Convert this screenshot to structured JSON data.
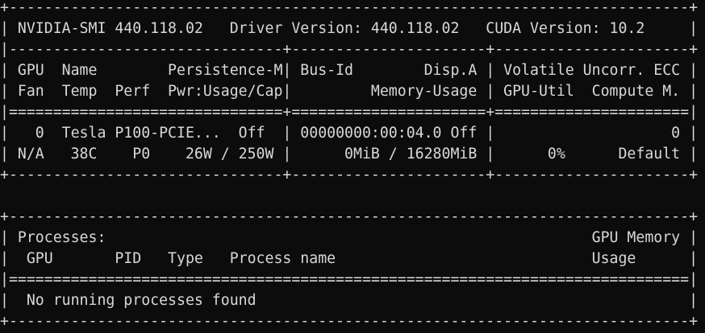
{
  "terminal": {
    "lines": [
      "+-----------------------------------------------------------------------------+",
      "| NVIDIA-SMI 440.118.02   Driver Version: 440.118.02   CUDA Version: 10.2     |",
      "|-------------------------------+----------------------+----------------------+",
      "| GPU  Name        Persistence-M| Bus-Id        Disp.A | Volatile Uncorr. ECC |",
      "| Fan  Temp  Perf  Pwr:Usage/Cap|         Memory-Usage | GPU-Util  Compute M. |",
      "|===============================+======================+======================|",
      "|   0  Tesla P100-PCIE...  Off  | 00000000:00:04.0 Off |                    0 |",
      "| N/A   38C    P0    26W / 250W |      0MiB / 16280MiB |      0%      Default |",
      "+-------------------------------+----------------------+----------------------+",
      "",
      "+-----------------------------------------------------------------------------+",
      "| Processes:                                                       GPU Memory |",
      "|  GPU       PID   Type   Process name                             Usage      |",
      "|=============================================================================|",
      "|  No running processes found                                                 |",
      "+-----------------------------------------------------------------------------+"
    ]
  }
}
